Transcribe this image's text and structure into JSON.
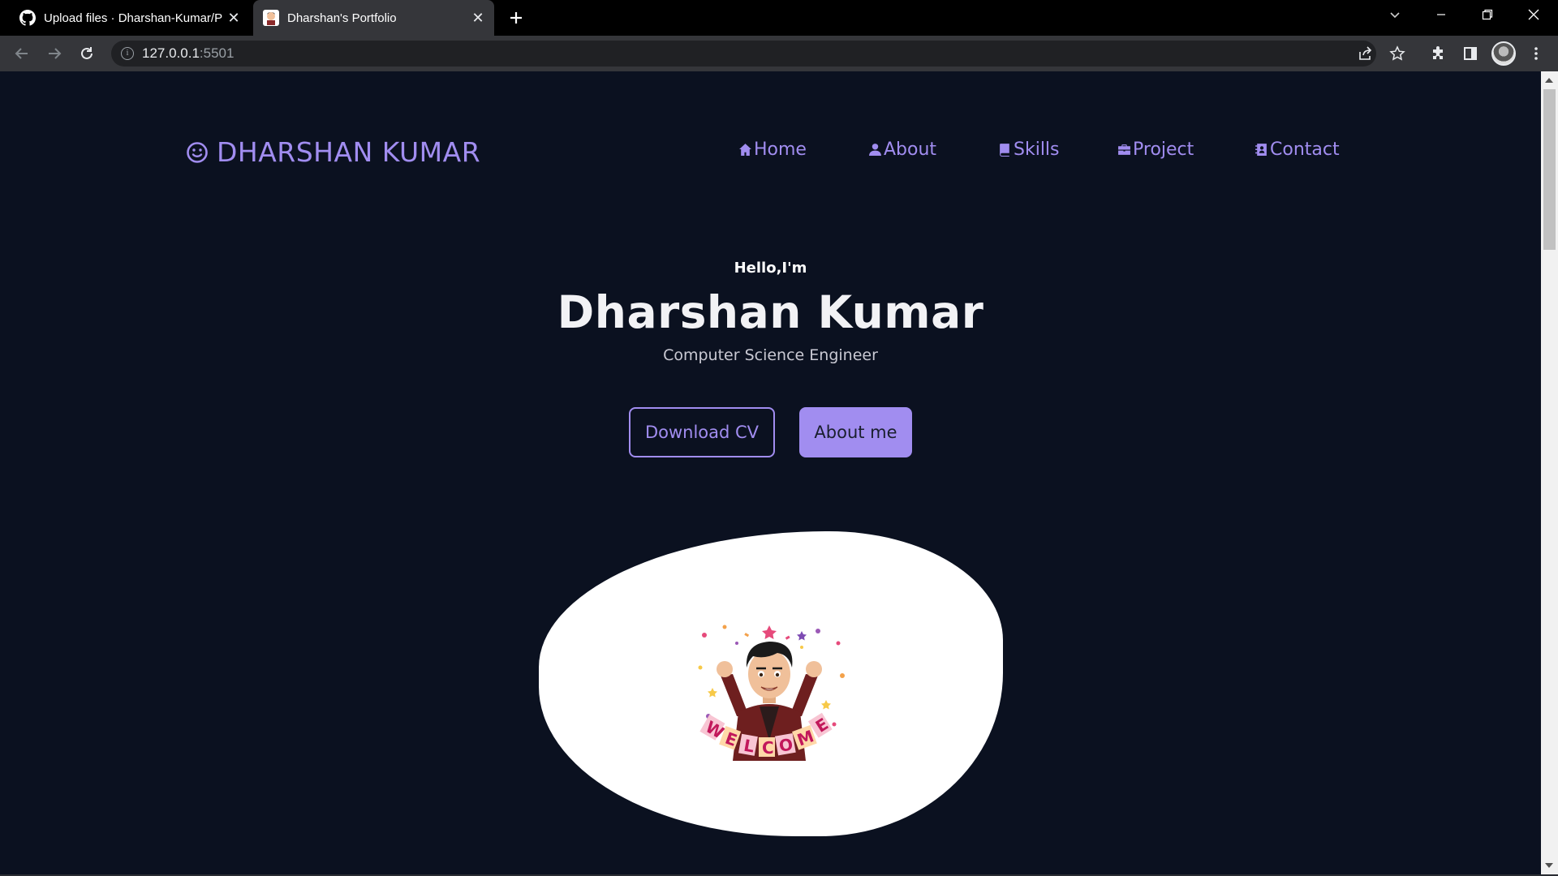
{
  "browser": {
    "tabs": [
      {
        "title": "Upload files · Dharshan-Kumar/P",
        "icon": "github-icon",
        "active": false
      },
      {
        "title": "Dharshan's Portfolio",
        "icon": "bitmoji-favicon-icon",
        "active": true
      }
    ],
    "url_host": "127.0.0.1",
    "url_port": ":5501"
  },
  "site": {
    "logo_text": "DHARSHAN KUMAR",
    "logo_icon": "smiley-icon",
    "nav": [
      {
        "label": "Home",
        "icon": "house-icon"
      },
      {
        "label": "About",
        "icon": "user-icon"
      },
      {
        "label": "Skills",
        "icon": "book-icon"
      },
      {
        "label": "Project",
        "icon": "briefcase-icon"
      },
      {
        "label": "Contact",
        "icon": "address-book-icon"
      }
    ],
    "hero": {
      "greeting": "Hello,I'm",
      "name": "Dharshan Kumar",
      "role": "Computer Science Engineer",
      "download_cv": "Download CV",
      "about_me": "About me",
      "banner_text": "WELCOME"
    }
  },
  "colors": {
    "background": "#0b1120",
    "accent": "#a18df0",
    "text": "#f2f2f5"
  }
}
